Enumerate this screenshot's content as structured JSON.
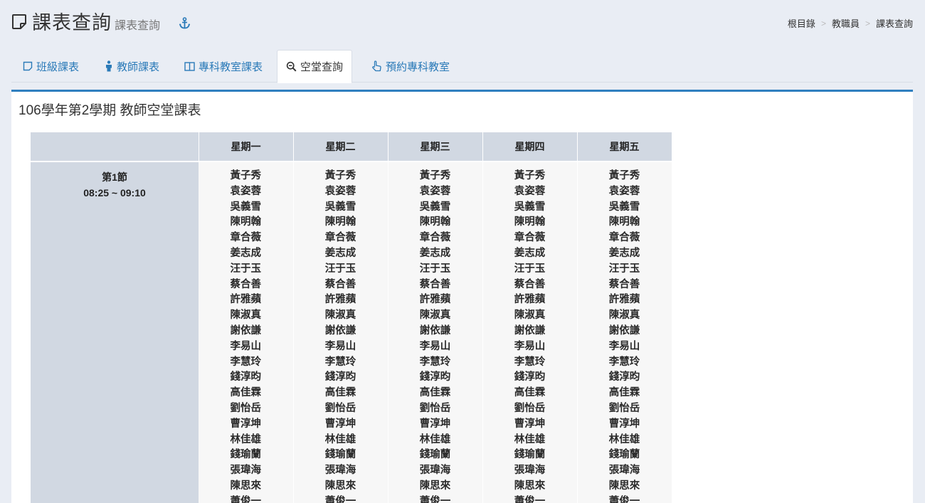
{
  "header": {
    "title": "課表查詢",
    "subtitle": "課表查詢",
    "breadcrumb": [
      "根目錄",
      "教職員",
      "課表查詢"
    ]
  },
  "tabs": [
    {
      "label": "班級課表",
      "icon": "square-icon"
    },
    {
      "label": "教師課表",
      "icon": "person-icon"
    },
    {
      "label": "專科教室課表",
      "icon": "columns-icon"
    },
    {
      "label": "空堂查詢",
      "icon": "zoom-out-icon",
      "active": true
    },
    {
      "label": "預約專科教室",
      "icon": "hand-pointer-icon"
    }
  ],
  "panel": {
    "title": "106學年第2學期 教師空堂課表"
  },
  "schedule": {
    "days": [
      "星期一",
      "星期二",
      "星期三",
      "星期四",
      "星期五"
    ],
    "periods": [
      {
        "label": "第1節",
        "time": "08:25 ~ 09:10",
        "teachers": [
          "黃子秀",
          "袁姿蓉",
          "吳義雪",
          "陳明翰",
          "章合薇",
          "姜志成",
          "汪于玉",
          "蔡合善",
          "許雅蘋",
          "陳淑真",
          "謝依謙",
          "李易山",
          "李慧玲",
          "錢淳昀",
          "高佳霖",
          "劉怡岳",
          "曹淳坤",
          "林佳雄",
          "錢瑜蘭",
          "張瑋海",
          "陳思來",
          "蕭俊一"
        ]
      }
    ]
  },
  "colors": {
    "accent": "#2f7fbf",
    "link": "#2a7ab8",
    "header_bg": "#d1d8e2",
    "page_bg": "#e9edf4"
  }
}
